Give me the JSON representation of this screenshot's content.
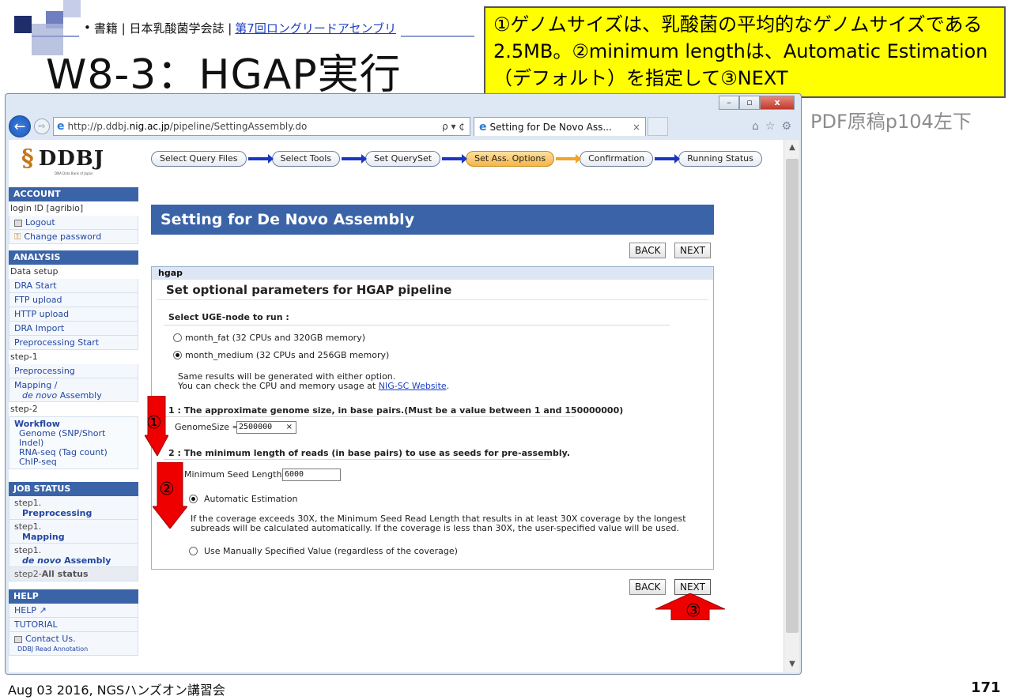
{
  "slide": {
    "book_bullet": "•",
    "book_prefix": "書籍 | 日本乳酸菌学会誌 |",
    "book_link": "第7回ロングリードアセンブリ",
    "title": "W8-3：HGAP実行",
    "note": "①ゲノムサイズは、乳酸菌の平均的なゲノムサイズである2.5MB。②minimum lengthは、Automatic Estimation（デフォルト）を指定して③NEXT",
    "side_note": "PDF原稿p104左下",
    "footer_left": "Aug 03 2016, NGSハンズオン講習会",
    "page_number": "171",
    "markers": [
      "①",
      "②",
      "③"
    ]
  },
  "browser": {
    "url_prefix": "http://p.ddbj.",
    "url_host": "nig.ac.jp",
    "url_path": "/pipeline/SettingAssembly.do",
    "url_tools": "ρ ▾ ¢",
    "tab_title": "Setting for De Novo Ass...",
    "tab_close": "×",
    "win_min": "–",
    "win_max": "▫",
    "win_close": "x",
    "back_icon": "left-arrow-icon",
    "fwd_icon": "right-arrow-icon"
  },
  "sidebar": {
    "logo": "DDBJ",
    "logo_sub": "DNA Data Bank of Japan",
    "account_head": "ACCOUNT",
    "login_id": "login ID [agribio]",
    "logout": "Logout",
    "change_password": "Change password",
    "analysis_head": "ANALYSIS",
    "data_setup": "Data setup",
    "data_items": [
      "DRA Start",
      "FTP upload",
      "HTTP upload",
      "DRA Import",
      "Preprocessing Start"
    ],
    "step1": "step-1",
    "preprocessing": "Preprocessing",
    "mapping_line1": "Mapping /",
    "mapping_line2_italic": "de novo",
    "mapping_line2_rest": " Assembly",
    "step2": "step-2",
    "workflow": "Workflow",
    "workflow_items": [
      "Genome (SNP/Short",
      "Indel)",
      "RNA-seq (Tag count)",
      "ChIP-seq"
    ],
    "job_head": "JOB STATUS",
    "job_items": [
      {
        "step": "step1.",
        "name": "Preprocessing"
      },
      {
        "step": "step1.",
        "name": "Mapping"
      },
      {
        "step": "step1.",
        "name_italic": "de novo",
        "name_rest": " Assembly"
      }
    ],
    "all_status_prefix": "step2-",
    "all_status_bold": "All status",
    "help_head": "HELP",
    "help_link": "HELP ↗",
    "tutorial": "TUTORIAL",
    "contact": "Contact Us.",
    "contact_sub": "DDBJ Read Annotation"
  },
  "steps": [
    "Select Query Files",
    "Select Tools",
    "Set QuerySet",
    "Set Ass. Options",
    "Confirmation",
    "Running Status"
  ],
  "active_step": "Set Ass. Options",
  "main": {
    "header": "Setting for De Novo Assembly",
    "back": "BACK",
    "next": "NEXT",
    "panel_head": "hgap",
    "panel_title": "Set optional parameters for HGAP pipeline",
    "uge_label": "Select UGE-node to run :",
    "node_fat": "month_fat (32 CPUs and 320GB memory)",
    "node_medium": "month_medium (32 CPUs and 256GB memory)",
    "node_selected": "month_medium",
    "same_results": "Same results will be generated with either option.",
    "cpu_check_prefix": "You can check the CPU and memory usage at ",
    "cpu_check_link": "NIG-SC Website",
    "cpu_check_suffix": ".",
    "q1": "1 : The approximate genome size, in base pairs.(Must be a value between 1 and 150000000)",
    "genome_label": "GenomeSize =",
    "genome_value": "2500000",
    "clear_icon": "×",
    "q2": "2 : The minimum length of reads (in base pairs) to use as seeds for pre-assembly.",
    "seed_label": "Minimum Seed Length :",
    "seed_value": "6000",
    "auto_label": "Automatic Estimation",
    "auto_desc": "If the coverage exceeds 30X, the Minimum Seed Read Length that results in at least 30X coverage by the longest subreads will be calculated automatically. If the coverage is less than 30X, the user-specified value will be used.",
    "manual_label": "Use Manually Specified Value (regardless of the coverage)",
    "seed_mode_selected": "Automatic Estimation"
  },
  "colors": {
    "accent_blue": "#3b64a8",
    "note_yellow": "#ffff00",
    "marker_red": "#ee0000",
    "step_active": "#f5b449"
  }
}
